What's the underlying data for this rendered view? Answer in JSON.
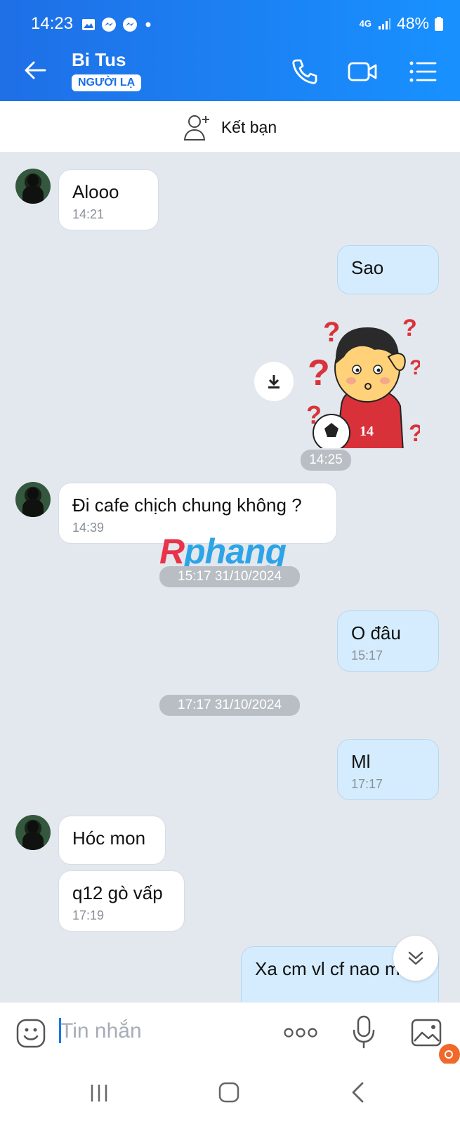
{
  "status": {
    "time": "14:23",
    "network": "4G",
    "battery": "48%"
  },
  "header": {
    "name": "Bi Tus",
    "badge": "NGƯỜI LẠ"
  },
  "friend_bar": {
    "label": "Kết bạn"
  },
  "messages": [
    {
      "text": "Alooo",
      "time": "14:21"
    },
    {
      "text": "Sao"
    },
    {
      "sticker_time": "14:25",
      "sticker_number": "14"
    },
    {
      "text": "Đi cafe chịch chung không ?",
      "time": "14:39"
    },
    {
      "separator": "15:17 31/10/2024"
    },
    {
      "text": "O đâu",
      "time": "15:17"
    },
    {
      "separator": "17:17 31/10/2024"
    },
    {
      "text": "Ml",
      "time": "17:17"
    },
    {
      "text": "Hóc mon"
    },
    {
      "text": "q12 gò vấp",
      "time": "17:19"
    },
    {
      "text": "Xa cm vl cf nao má"
    }
  ],
  "watermark": {
    "first": "R",
    "rest": "phang"
  },
  "input": {
    "placeholder": "Tin nhắn"
  },
  "colors": {
    "header": "#1a7ff0",
    "bubble_out": "#d4ecfd",
    "bubble_in": "#ffffff",
    "chat_bg": "#e3e8ee"
  }
}
